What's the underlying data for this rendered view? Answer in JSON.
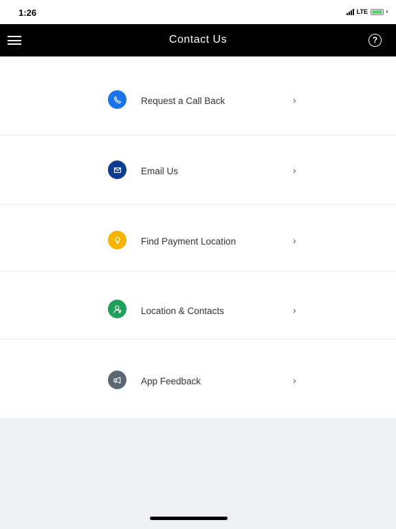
{
  "status_bar": {
    "time": "1:26",
    "network": "LTE"
  },
  "header": {
    "title": "Contact Us",
    "help_glyph": "?"
  },
  "menu": {
    "items": [
      {
        "label": "Request a Call Back",
        "icon": "phone-icon",
        "color": "#1a73e8",
        "chevron": "›"
      },
      {
        "label": "Email Us",
        "icon": "envelope-icon",
        "color": "#0d3d91",
        "chevron": "›"
      },
      {
        "label": "Find Payment Location",
        "icon": "lightbulb-icon",
        "color": "#f5b400",
        "chevron": "›"
      },
      {
        "label": "Location & Contacts",
        "icon": "location-contact-icon",
        "color": "#1fa05a",
        "chevron": "›"
      },
      {
        "label": "App Feedback",
        "icon": "megaphone-icon",
        "color": "#5b6673",
        "chevron": "›"
      }
    ]
  }
}
